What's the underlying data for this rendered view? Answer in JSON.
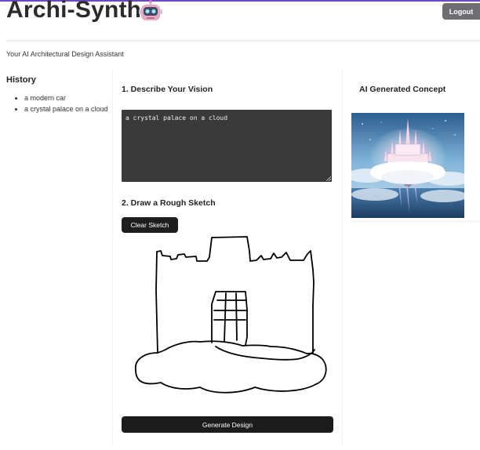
{
  "header": {
    "app_title": "Archi-Synth",
    "logo_icon": "robot-icon",
    "logout_label": "Logout",
    "subtitle": "Your AI Architectural Design Assistant"
  },
  "history": {
    "title": "History",
    "items": [
      "a modern car",
      "a crystal palace on a cloud"
    ]
  },
  "describe": {
    "title": "1. Describe Your Vision",
    "value": "a crystal palace on a cloud"
  },
  "sketch": {
    "title": "2. Draw a Rough Sketch",
    "clear_label": "Clear Sketch",
    "generate_label": "Generate Design"
  },
  "concept": {
    "title": "AI Generated Concept",
    "image_icon": "crystal-palace-render"
  },
  "colors": {
    "accent_line": "#6b47c9",
    "button_dark": "#1e1e1e",
    "logout_gray": "#6e6e72",
    "input_bg": "#3a3a3a"
  }
}
